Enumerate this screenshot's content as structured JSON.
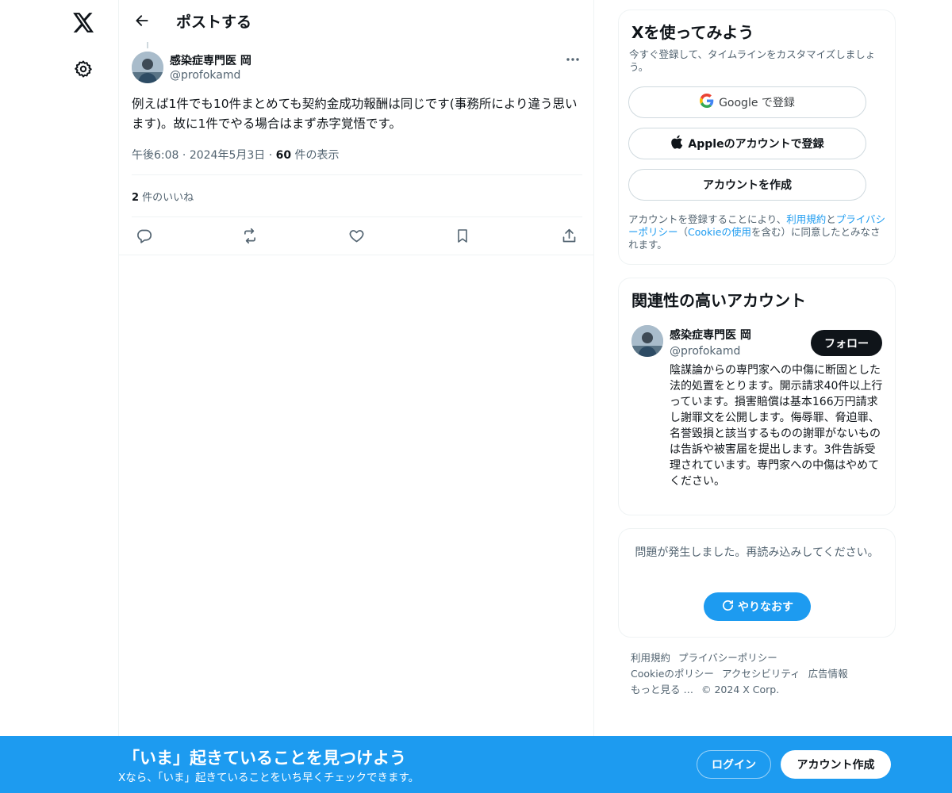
{
  "nav": {
    "logo_icon": "x-logo-icon",
    "settings_icon": "gear-icon"
  },
  "header": {
    "title": "ポストする",
    "back_icon": "arrow-left-icon"
  },
  "post": {
    "author_name": "感染症専門医 岡",
    "author_handle": "@profokamd",
    "text": "例えば1件でも10件まとめても契約金成功報酬は同じです(事務所により違う思います)。故に1件でやる場合はまず赤字覚悟です。",
    "time": "午後6:08",
    "date": "2024年5月3日",
    "view_count": "60",
    "view_suffix": " 件の表示",
    "like_count": "2",
    "like_suffix": " 件のいいね",
    "actions": [
      "reply-icon",
      "repost-icon",
      "like-icon",
      "bookmark-icon",
      "share-icon"
    ]
  },
  "signup": {
    "title": "Xを使ってみよう",
    "subtitle": "今すぐ登録して、タイムラインをカスタマイズしましょう。",
    "google_label": "Google で登録",
    "apple_label": "Appleのアカウントで登録",
    "create_label": "アカウントを作成",
    "legal_prefix": "アカウントを登録することにより、",
    "legal_terms": "利用規約",
    "legal_and": "と",
    "legal_privacy": "プライバシーポリシー",
    "legal_paren_open": "（",
    "legal_cookie": "Cookieの使用",
    "legal_suffix": "を含む）に同意したとみなされます。"
  },
  "related": {
    "title": "関連性の高いアカウント",
    "name": "感染症専門医 岡",
    "handle": "@profokamd",
    "follow_label": "フォロー",
    "bio": "陰謀論からの専門家への中傷に断固とした法的処置をとります。開示請求40件以上行っています。損害賠償は基本166万円請求し謝罪文を公開します。侮辱罪、脅迫罪、名誉毀損と該当するものの謝罪がないものは告訴や被害届を提出します。3件告訴受理されています。専門家への中傷はやめてください。"
  },
  "error": {
    "message": "問題が発生しました。再読み込みしてください。",
    "retry_label": "やりなおす"
  },
  "footer": {
    "links": [
      "利用規約",
      "プライバシーポリシー",
      "Cookieのポリシー",
      "アクセシビリティ",
      "広告情報",
      "もっと見る …",
      "© 2024 X Corp."
    ]
  },
  "bottom_bar": {
    "title": "「いま」起きていることを見つけよう",
    "subtitle": "Xなら、「いま」起きていることをいち早くチェックできます。",
    "login_label": "ログイン",
    "signup_label": "アカウント作成"
  },
  "colors": {
    "accent": "#1d9bf0",
    "text": "#0f1419",
    "muted": "#536471",
    "border": "#eff3f4"
  }
}
